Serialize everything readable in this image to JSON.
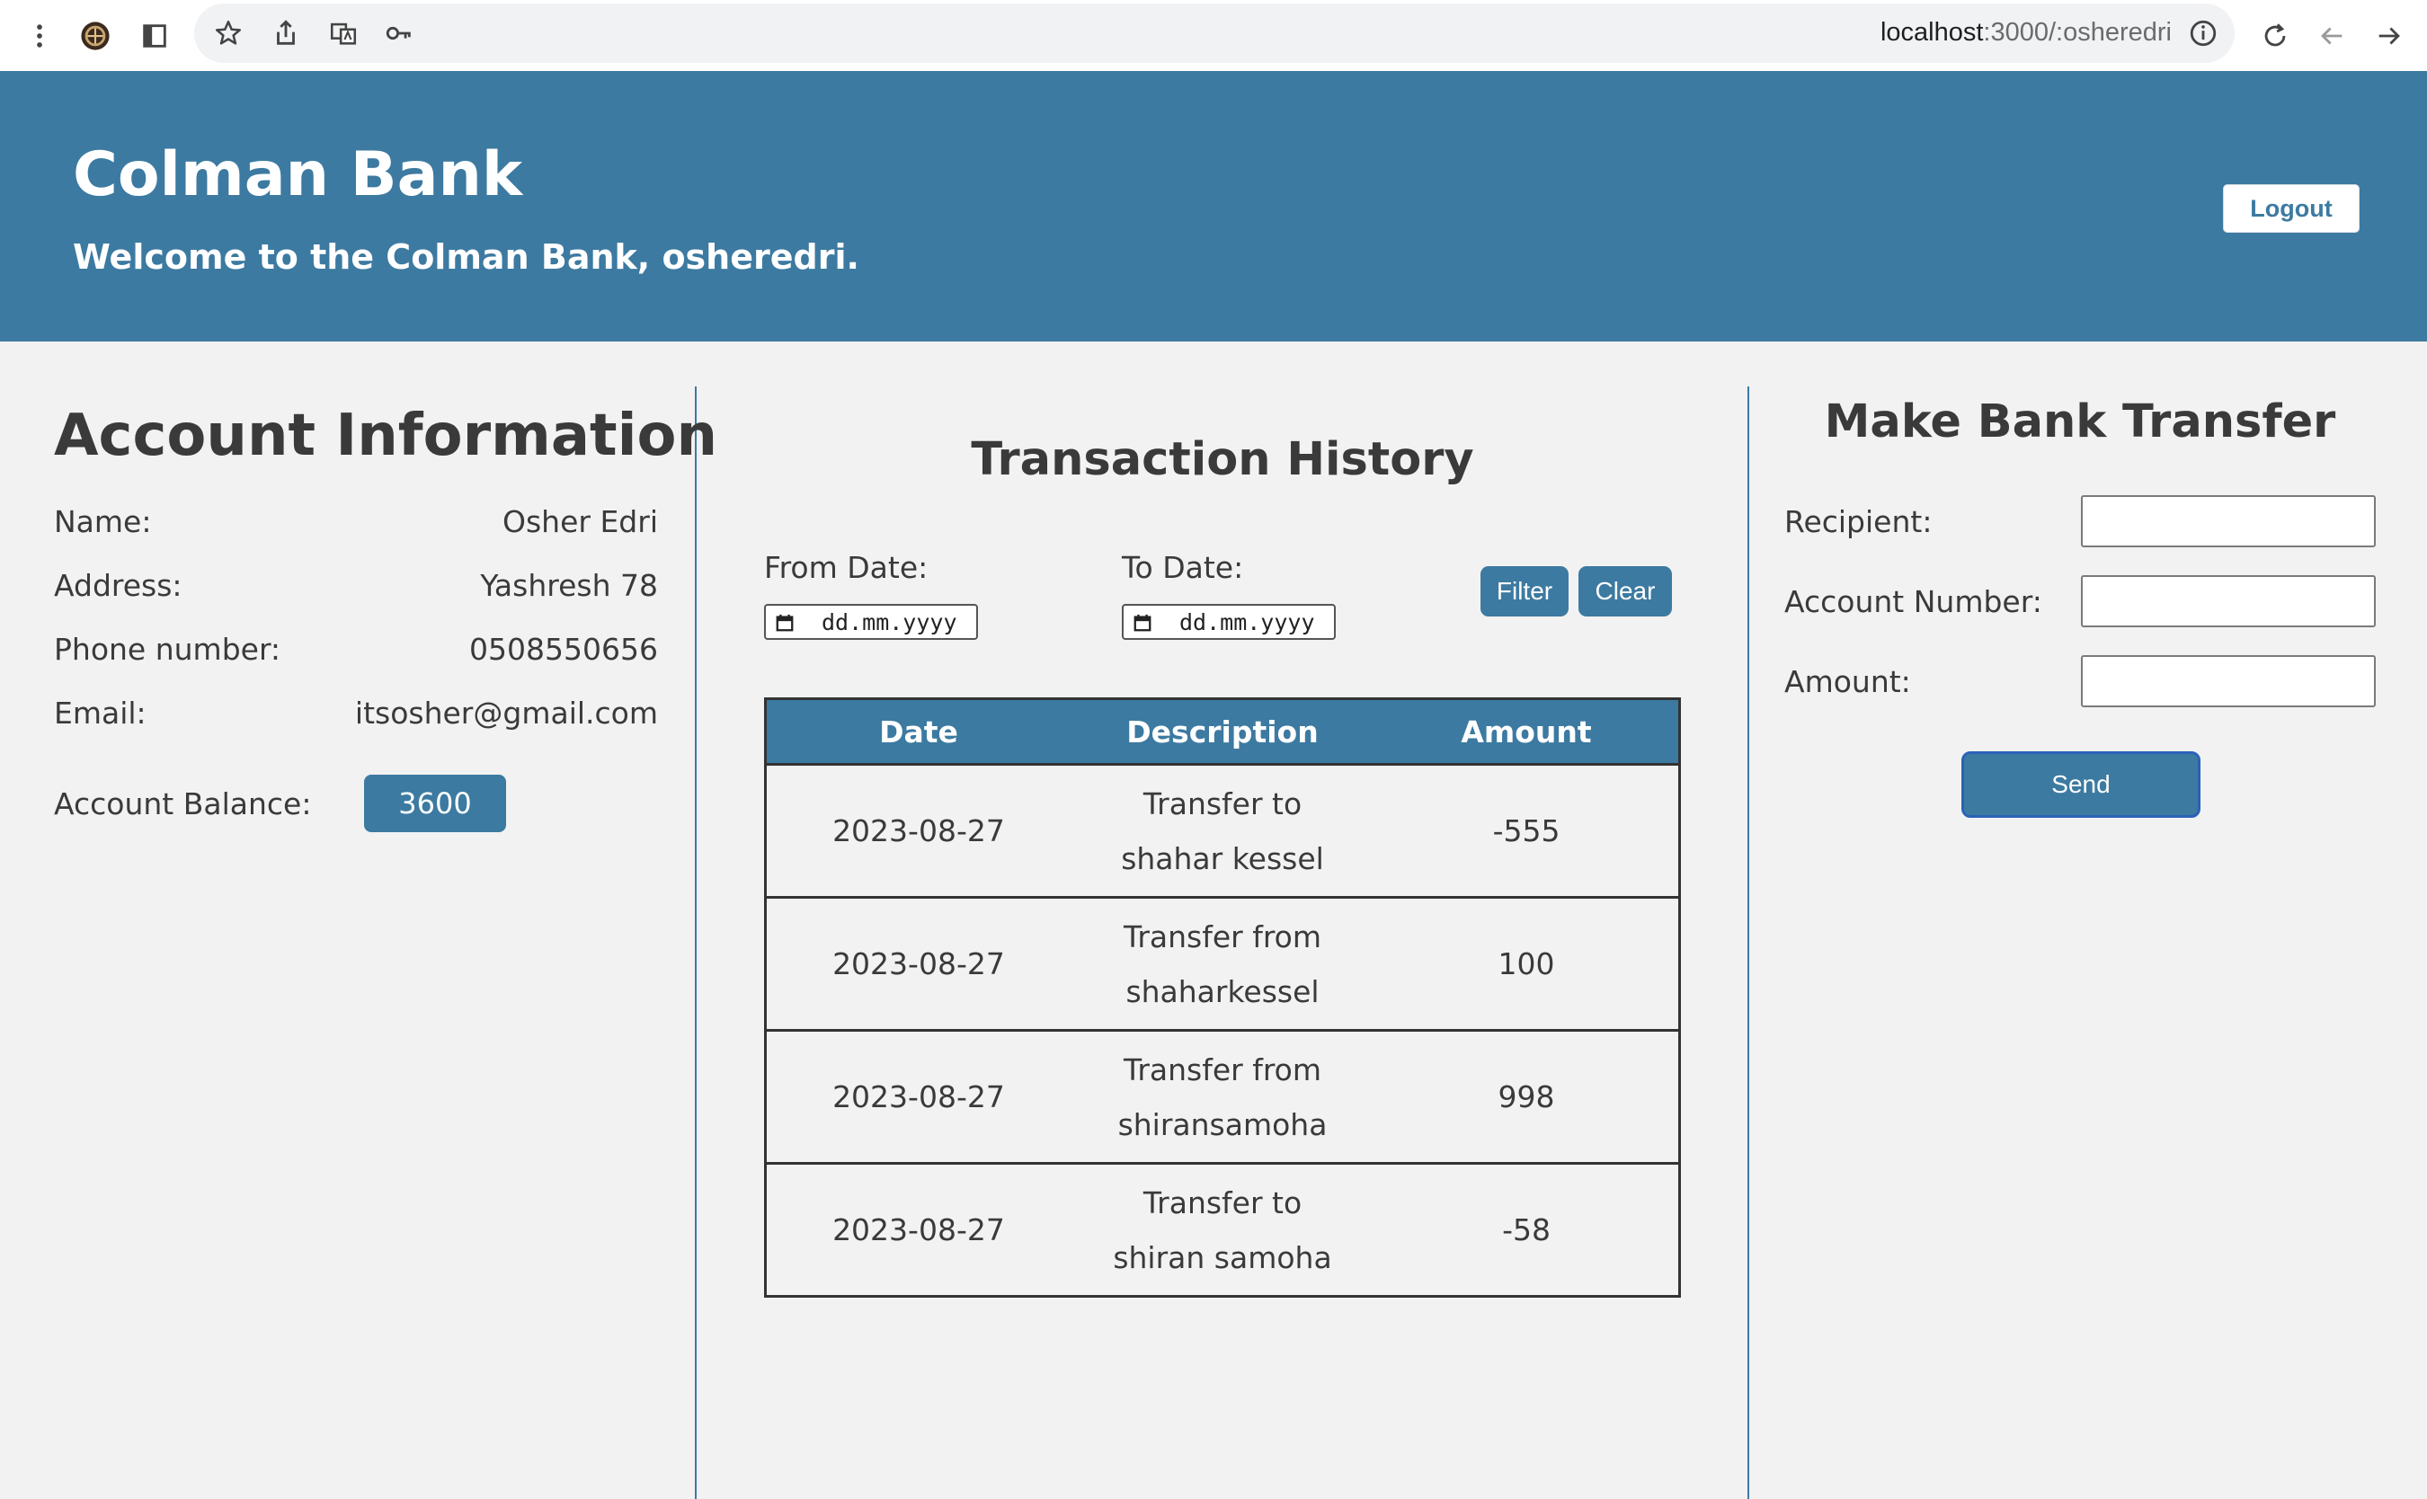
{
  "browser": {
    "url_host": "localhost",
    "url_path": ":3000/:osheredri"
  },
  "header": {
    "brand": "Colman Bank",
    "welcome": "Welcome to the Colman Bank, osheredri.",
    "logout_label": "Logout"
  },
  "account": {
    "title": "Account Information",
    "rows": [
      {
        "label": "Name:",
        "value": "Osher Edri"
      },
      {
        "label": "Address:",
        "value": "Yashresh 78"
      },
      {
        "label": "Phone number:",
        "value": "0508550656"
      },
      {
        "label": "Email:",
        "value": "itsosher@gmail.com"
      }
    ],
    "balance_label": "Account Balance:",
    "balance_value": "3600"
  },
  "history": {
    "title": "Transaction History",
    "from_label": "From Date:",
    "to_label": "To Date:",
    "date_placeholder": "dd.mm.yyyy",
    "filter_label": "Filter",
    "clear_label": "Clear",
    "columns": [
      "Date",
      "Description",
      "Amount"
    ],
    "rows": [
      {
        "date": "2023-08-27",
        "description": "Transfer to shahar kessel",
        "amount": "-555"
      },
      {
        "date": "2023-08-27",
        "description": "Transfer from shaharkessel",
        "amount": "100"
      },
      {
        "date": "2023-08-27",
        "description": "Transfer from shiransamoha",
        "amount": "998"
      },
      {
        "date": "2023-08-27",
        "description": "Transfer to shiran samoha",
        "amount": "-58"
      }
    ]
  },
  "transfer": {
    "title": "Make Bank Transfer",
    "recipient_label": "Recipient:",
    "account_label": "Account Number:",
    "amount_label": "Amount:",
    "recipient_value": "",
    "account_value": "",
    "amount_value": "",
    "send_label": "Send"
  },
  "colors": {
    "primary": "#3c7aa1",
    "background": "#f2f2f2",
    "text": "#3a3a3a"
  }
}
